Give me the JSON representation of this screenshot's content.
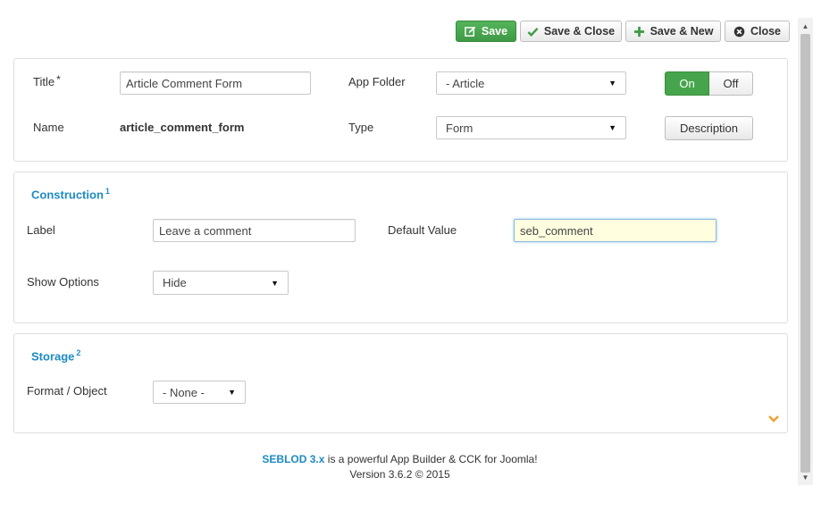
{
  "toolbar": {
    "save_label": "Save",
    "save_close_label": "Save & Close",
    "save_new_label": "Save & New",
    "close_label": "Close"
  },
  "general": {
    "title_label": "Title",
    "required_mark": "*",
    "title_value": "Article Comment Form",
    "app_folder_label": "App Folder",
    "app_folder_value": "- Article",
    "toggle_on": "On",
    "toggle_off": "Off",
    "name_label": "Name",
    "name_value": "article_comment_form",
    "type_label": "Type",
    "type_value": "Form",
    "description_label": "Description"
  },
  "construction": {
    "title": "Construction",
    "sup": "1",
    "label_label": "Label",
    "label_value": "Leave a comment",
    "default_value_label": "Default Value",
    "default_value": "seb_comment",
    "show_options_label": "Show Options",
    "show_options_value": "Hide"
  },
  "storage": {
    "title": "Storage",
    "sup": "2",
    "format_label": "Format / Object",
    "format_value": "- None -"
  },
  "footer": {
    "brand": "SEBLOD 3.x",
    "tagline": " is a powerful App Builder & CCK for Joomla!",
    "version": "Version 3.6.2 © 2015"
  },
  "colors": {
    "accent": "#1d8bc2",
    "save_green": "#46a54c",
    "focus_bg": "#ffffe0"
  }
}
